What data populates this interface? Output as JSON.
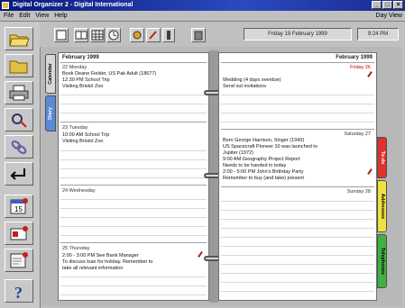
{
  "window": {
    "title": "Digital Organizer 2 - Digital International"
  },
  "menubar": {
    "items": [
      "File",
      "Edit",
      "View",
      "Help"
    ],
    "right_text": "Day View"
  },
  "toolbar": {
    "date_display": "Friday 19 February 1999",
    "time_display": "9:24 PM"
  },
  "left_page": {
    "header": "February 1999",
    "days": [
      {
        "heading": "22 Monday",
        "entries": [
          "Book Deane Fielder, US Pak Adult (18677)",
          "12:30 PM  School Trip",
          "      Visiting Bristol Zoo"
        ]
      },
      {
        "heading": "23 Tuesday",
        "entries": [
          "10:00 AM  School Trip",
          "      Visiting Bristol Zoo"
        ]
      },
      {
        "heading": "24 Wednesday",
        "entries": []
      },
      {
        "heading": "25 Thursday",
        "entries": [
          "2:00 - 3:00 PM  See Bank Manager",
          "   To discuss loan for holiday. Remember to",
          "   take all relevant information"
        ]
      }
    ]
  },
  "right_page": {
    "header": "February 1999",
    "top_label": "Friday 26",
    "days": [
      {
        "heading": "",
        "entries": [
          "Wedding (4 days overdue)",
          "   Send out invitations"
        ]
      },
      {
        "heading": "Saturday 27",
        "entries": [
          "Born George Harrison, Singer (1943)",
          "US Spacecraft Pioneer 10 was launched to",
          "Jupiter (1972)",
          "9:00 AM  Geography Project Report",
          "   Needs to be handed in today",
          "2:00 - 5:00 PM  John's Birthday Party",
          "   Remember to buy (and take) present"
        ]
      },
      {
        "heading": "Sunday 28",
        "entries": []
      }
    ]
  },
  "left_tabs": [
    "Calendar",
    "Diary"
  ],
  "right_tabs": [
    "To-do",
    "Addresses",
    "Telephones"
  ],
  "colors": {
    "titlebar": "#0a1a7a",
    "tab_todo": "#e03030",
    "tab_addresses": "#f0e040",
    "tab_telephones": "#40b040",
    "tab_diary": "#5a8ad8",
    "red_text": "#c00000"
  },
  "icons": {
    "left_tools": [
      "open-folder-icon",
      "folder-icon",
      "printer-icon",
      "link-icon",
      "chain-icon",
      "return-arrow-icon",
      "calendar-page-icon",
      "card-icon",
      "note-icon",
      "help-icon"
    ],
    "top_tools": [
      "notebook-icon",
      "week-view-icon",
      "month-view-icon",
      "clock-icon",
      "tools-icon",
      "pen-icon",
      "trash-icon"
    ]
  }
}
